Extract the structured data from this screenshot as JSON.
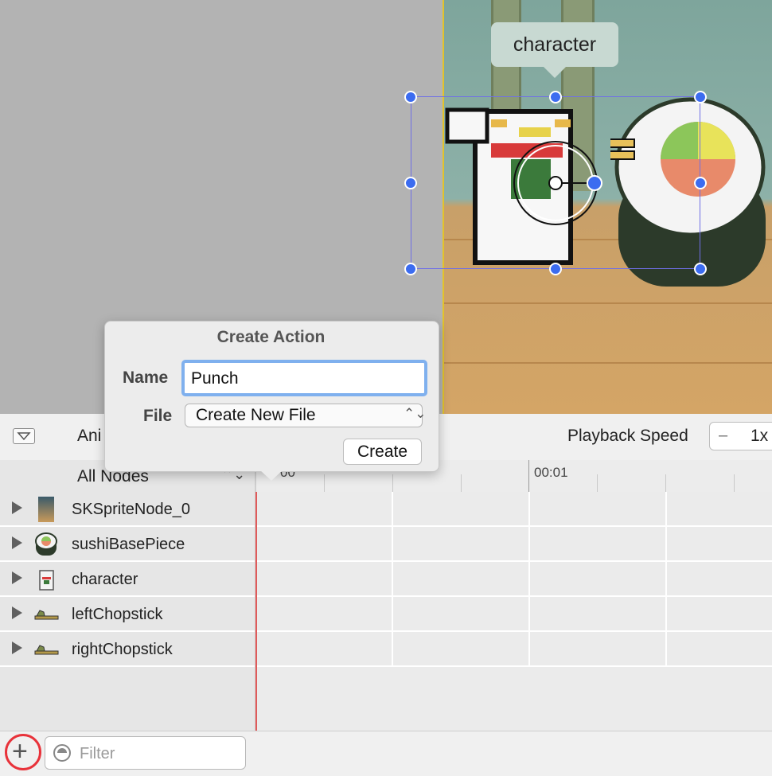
{
  "scene": {
    "tooltip": "character"
  },
  "toolbar": {
    "animation_label": "Ani",
    "playback_speed_label": "Playback Speed",
    "speed_minus": "–",
    "speed_value": "1x"
  },
  "timeline": {
    "nodes_filter": "All Nodes",
    "nodes_filter_arrows": "⌃⌄",
    "ruler_start": "00",
    "ruler_time": "00:01"
  },
  "nodes": [
    {
      "label": "SKSpriteNode_0",
      "icon": "sprite-node-icon"
    },
    {
      "label": "sushiBasePiece",
      "icon": "sushi-icon"
    },
    {
      "label": "character",
      "icon": "cat-character-icon"
    },
    {
      "label": "leftChopstick",
      "icon": "chopstick-icon"
    },
    {
      "label": "rightChopstick",
      "icon": "chopstick-icon"
    }
  ],
  "bottom": {
    "add": "+",
    "filter_placeholder": "Filter"
  },
  "popover": {
    "title": "Create Action",
    "name_label": "Name",
    "name_value": "Punch",
    "file_label": "File",
    "file_value": "Create New File",
    "file_arrows": "⌃⌄",
    "create_button": "Create"
  },
  "colors": {
    "selection_handle": "#3c6cf0",
    "playhead": "#e05a5a",
    "focus_ring": "#7fb0ee",
    "add_highlight": "#e8323a"
  }
}
